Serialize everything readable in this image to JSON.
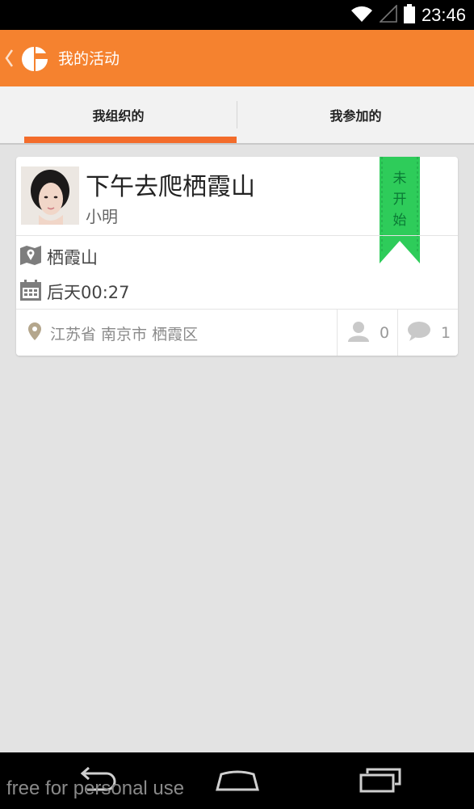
{
  "status_bar": {
    "time": "23:46",
    "icons": [
      "wifi-icon",
      "signal-icon",
      "battery-icon"
    ]
  },
  "app_bar": {
    "title": "我的活动",
    "icons": [
      "back-chevron-icon",
      "app-logo-icon"
    ]
  },
  "tabs": [
    {
      "label": "我组织的",
      "selected": true
    },
    {
      "label": "我参加的",
      "selected": false
    }
  ],
  "activity": {
    "title": "下午去爬栖霞山",
    "organizer": "小明",
    "status_ribbon": "未开始",
    "place": "栖霞山",
    "time": "后天00:27",
    "location": "江苏省 南京市 栖霞区",
    "participants": "0",
    "comments": "1"
  },
  "nav_bar": {
    "buttons": [
      "back-nav-icon",
      "home-nav-icon",
      "recents-nav-icon"
    ]
  },
  "watermark": "free for personal use",
  "colors": {
    "accent": "#f5822f",
    "tab_indicator": "#f36c2b",
    "ribbon": "#2ecc5a",
    "background": "#e3e3e3"
  }
}
